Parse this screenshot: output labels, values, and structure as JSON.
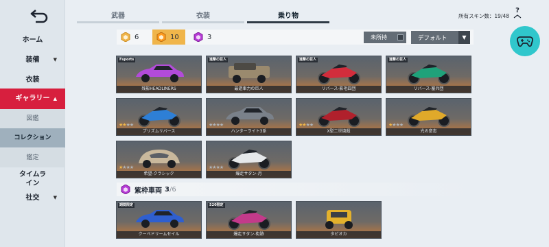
{
  "sidebar": {
    "back_icon": "back-arrow-icon",
    "items": [
      {
        "label": "ホーム"
      },
      {
        "label": "装備",
        "has_arrow": true
      },
      {
        "label": "衣装"
      },
      {
        "label": "ギャラリー",
        "has_arrow": true,
        "active": true
      },
      {
        "label": "図鑑"
      },
      {
        "label": "コレクション",
        "selected": true
      },
      {
        "label": "鑑定"
      },
      {
        "label": "タイムライン"
      },
      {
        "label": "社交",
        "has_arrow": true
      }
    ],
    "arrow_glyph": "▼",
    "active_arrow_glyph": "▲"
  },
  "tabs": [
    {
      "label": "武器"
    },
    {
      "label": "衣装"
    },
    {
      "label": "乗り物",
      "active": true
    }
  ],
  "header": {
    "skin_count_text": "所有スキン数：19/48",
    "help_label": "?"
  },
  "filters": {
    "chips": [
      {
        "count": "6",
        "color": "#f0b54a"
      },
      {
        "count": "10",
        "color": "#f0b54a",
        "active": true
      },
      {
        "count": "3",
        "color": "#b63bd6"
      }
    ],
    "not_owned_label": "未所持",
    "sort_label": "デフォルト",
    "sort_caret": "▼"
  },
  "vehicles": [
    {
      "name": "残影HEADLINERS",
      "tag": "Fsports",
      "stars": 0,
      "color": "#b24bd9",
      "kind": "car"
    },
    {
      "name": "最遊車力の巨人",
      "tag": "進撃の巨人",
      "stars": 0,
      "color": "#9a8a6e",
      "kind": "truck"
    },
    {
      "name": "リバース-影毛四団",
      "tag": "進撃の巨人",
      "stars": 0,
      "color": "#d22d3c",
      "kind": "bike"
    },
    {
      "name": "リバース-塞兵団",
      "tag": "進撃の巨人",
      "stars": 0,
      "color": "#1fa27a",
      "kind": "bike"
    },
    {
      "name": "プリズムリバース",
      "tag": "",
      "stars": 2,
      "color": "#2e7fd6",
      "kind": "bike"
    },
    {
      "name": "ハンターライト3系",
      "tag": "",
      "stars": 0,
      "color": "#7a818a",
      "kind": "car"
    },
    {
      "name": "X型二世焼殺",
      "tag": "",
      "stars": 2,
      "color": "#b0202c",
      "kind": "bike"
    },
    {
      "name": "光の意志",
      "tag": "",
      "stars": 1,
      "color": "#e0a92a",
      "kind": "bike"
    },
    {
      "name": "希望-クラシック",
      "tag": "",
      "stars": 1,
      "color": "#c9b89c",
      "kind": "beetle"
    },
    {
      "name": "爆走サタン-月",
      "tag": "",
      "stars": 0,
      "color": "#e6e8ea",
      "kind": "bike"
    }
  ],
  "limited_section": {
    "title": "紫枠車両",
    "owned": "3",
    "total": "/6"
  },
  "limited_vehicles": [
    {
      "name": "クーペドリームセイル",
      "tag": "期間限定",
      "color": "#2f5fcf",
      "kind": "car"
    },
    {
      "name": "爆走サタン-街跡",
      "tag": "S20限定",
      "color": "#c33a8a",
      "kind": "bike"
    },
    {
      "name": "タピオカ",
      "tag": "",
      "color": "#e3b12c",
      "kind": "buggy"
    }
  ],
  "colors": {
    "accent_red": "#d71f3e",
    "gold": "#f0b54a",
    "purple": "#b63bd6",
    "cyan_button": "#30c7cc"
  }
}
